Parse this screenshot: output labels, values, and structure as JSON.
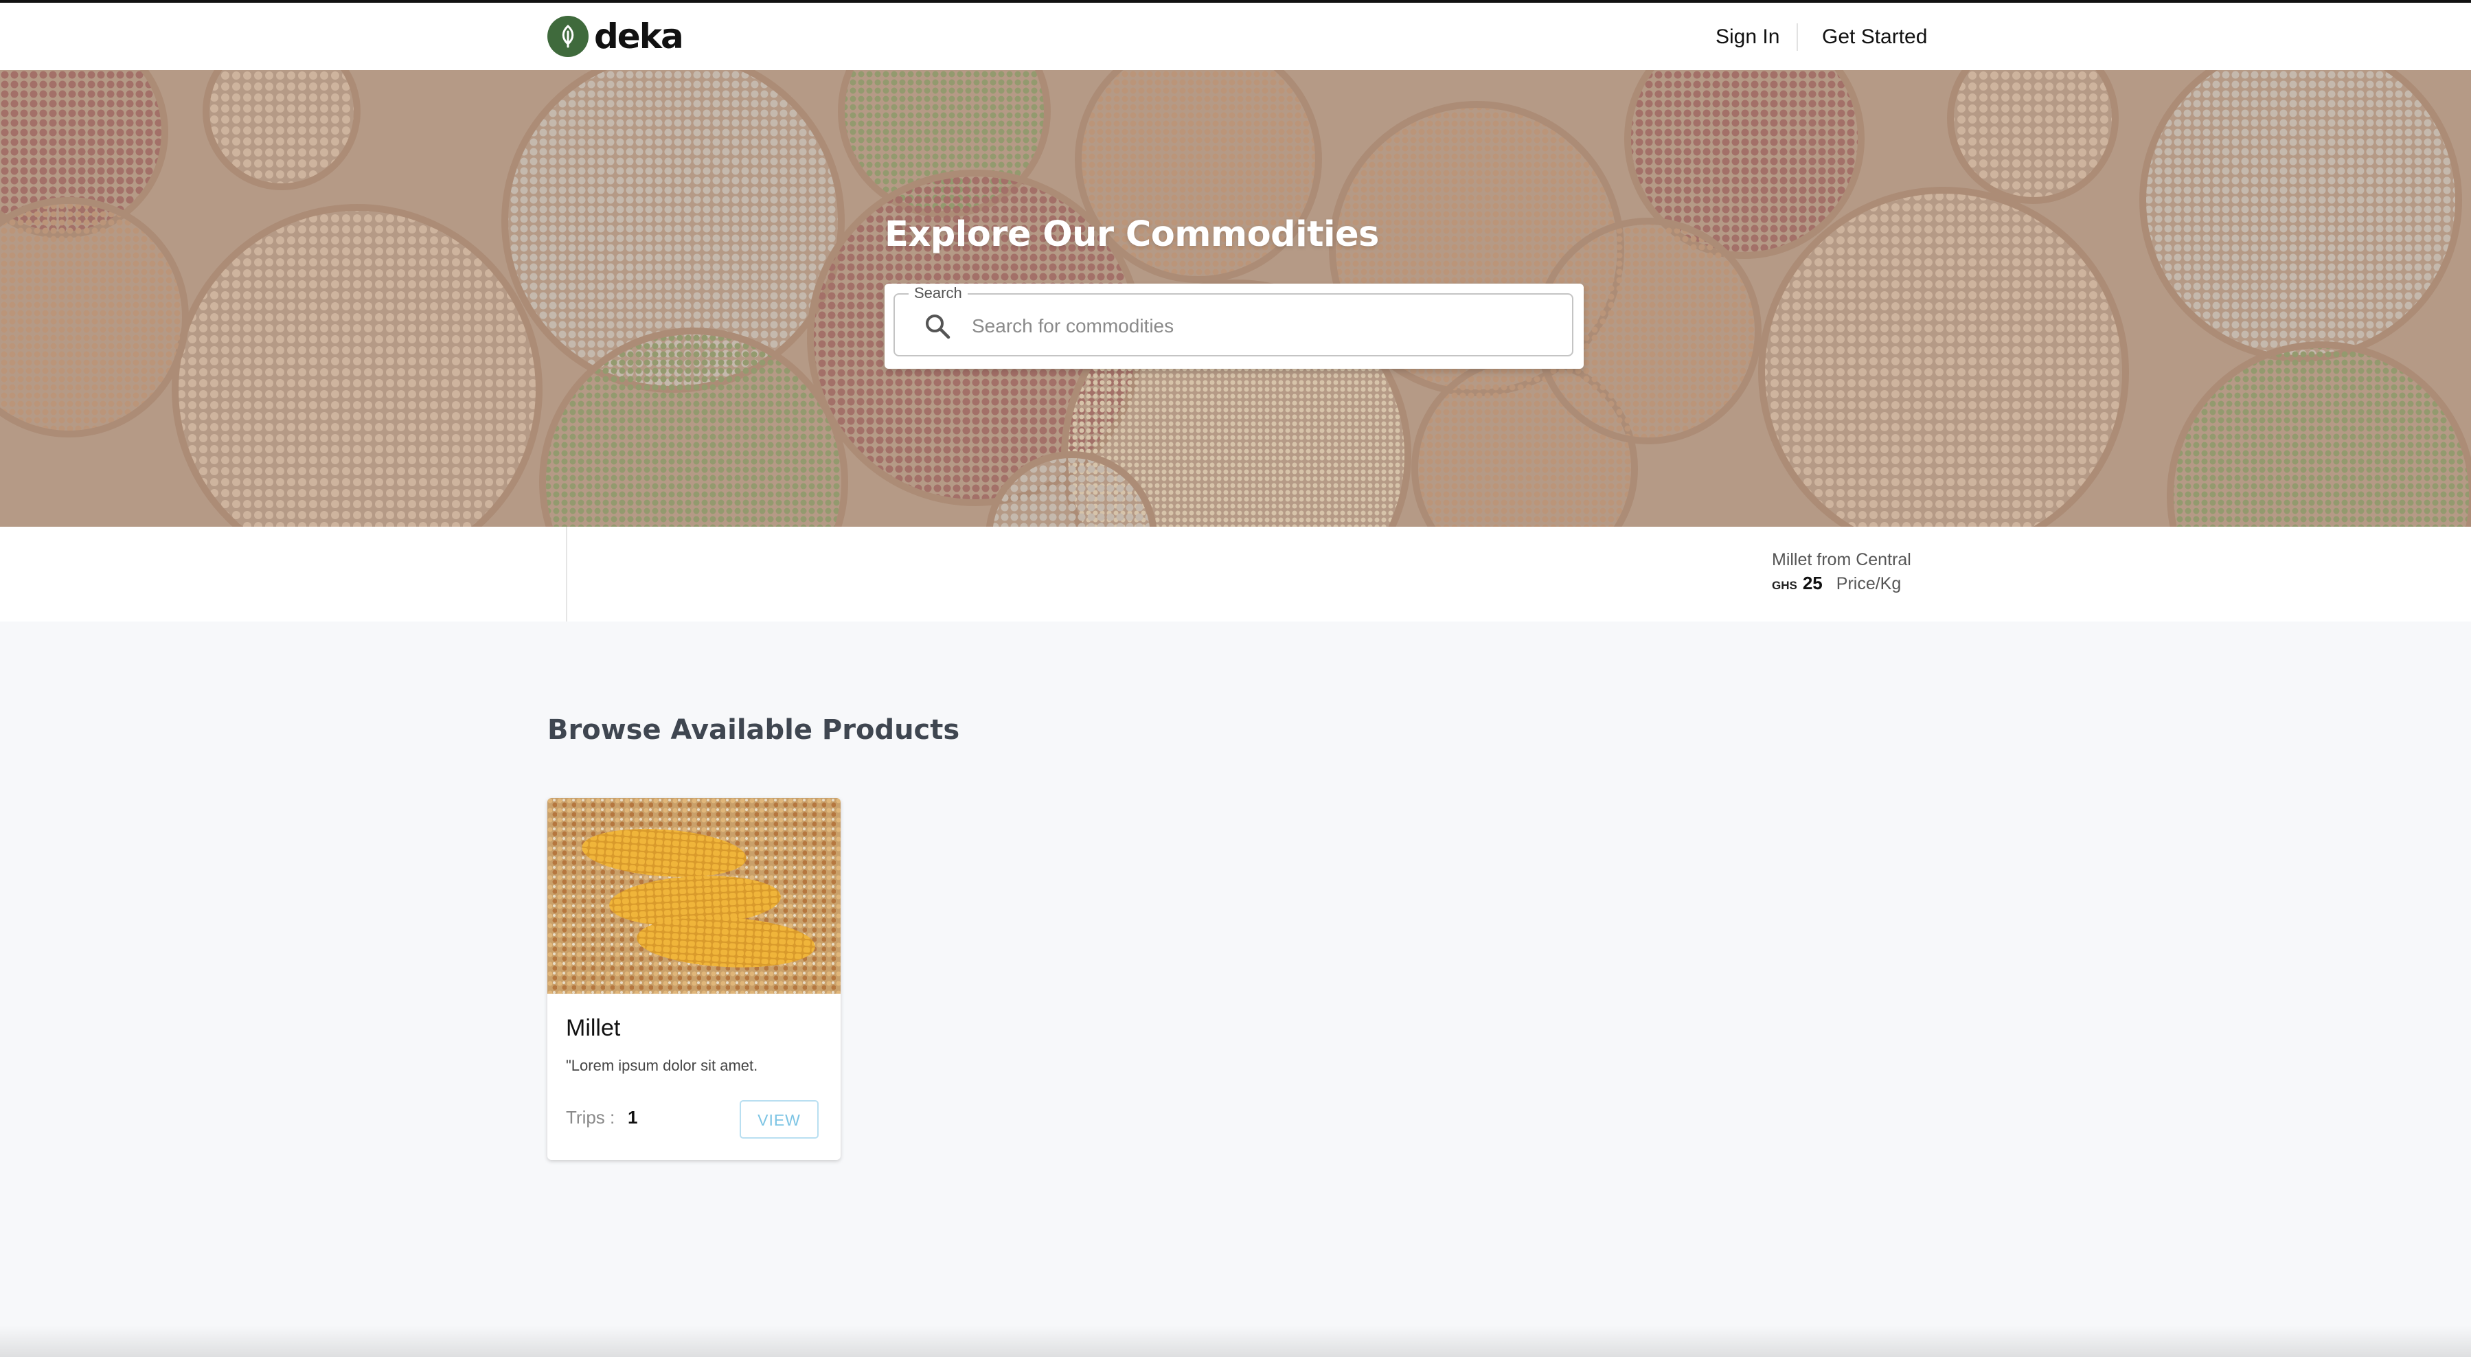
{
  "header": {
    "brand": "deka",
    "nav": {
      "sign_in": "Sign In",
      "get_started": "Get Started"
    }
  },
  "hero": {
    "title": "Explore Our Commodities",
    "search": {
      "label": "Search",
      "placeholder": "Search for commodities"
    }
  },
  "ticker": {
    "items": [
      {
        "name": "Millet from Central",
        "currency": "GHS",
        "price": "25",
        "unit": "Price/Kg"
      }
    ]
  },
  "products": {
    "section_title": "Browse Available Products",
    "items": [
      {
        "title": "Millet",
        "description": "\"Lorem ipsum dolor sit amet.",
        "trips_label": "Trips :",
        "trips_value": "1",
        "view_label": "VIEW"
      }
    ]
  },
  "colors": {
    "brand_green": "#3f6a3c",
    "view_button": "#7cc4e4",
    "heading": "#3f4650"
  }
}
